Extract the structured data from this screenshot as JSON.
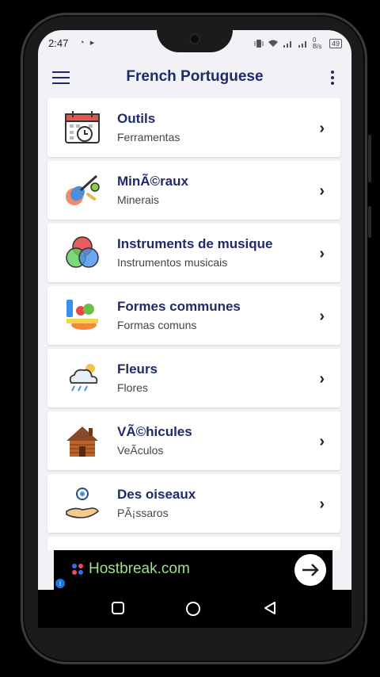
{
  "status": {
    "time": "2:47",
    "left_icons": "◔ ▸",
    "right_text": "0 B/s",
    "battery": "49"
  },
  "appbar": {
    "title": "French Portuguese"
  },
  "items": [
    {
      "title": "Outils",
      "subtitle": "Ferramentas",
      "icon": "calendar-clock-icon"
    },
    {
      "title": "MinÃ©raux",
      "subtitle": "Minerais",
      "icon": "guitar-ball-icon"
    },
    {
      "title": "Instruments de musique",
      "subtitle": "Instrumentos musicais",
      "icon": "venn-circles-icon"
    },
    {
      "title": "Formes communes",
      "subtitle": "Formas comuns",
      "icon": "groceries-icon"
    },
    {
      "title": "Fleurs",
      "subtitle": "Flores",
      "icon": "weather-cloud-icon"
    },
    {
      "title": "VÃ©hicules",
      "subtitle": "VeÃ­culos",
      "icon": "house-icon"
    },
    {
      "title": "Des oiseaux",
      "subtitle": "PÃ¡ssaros",
      "icon": "hand-money-icon"
    }
  ],
  "ad": {
    "brand": "Hostbreak.com",
    "brand_color": "#9fe08a"
  },
  "colors": {
    "accent": "#1f2a6b",
    "background": "#f2f2f6"
  }
}
